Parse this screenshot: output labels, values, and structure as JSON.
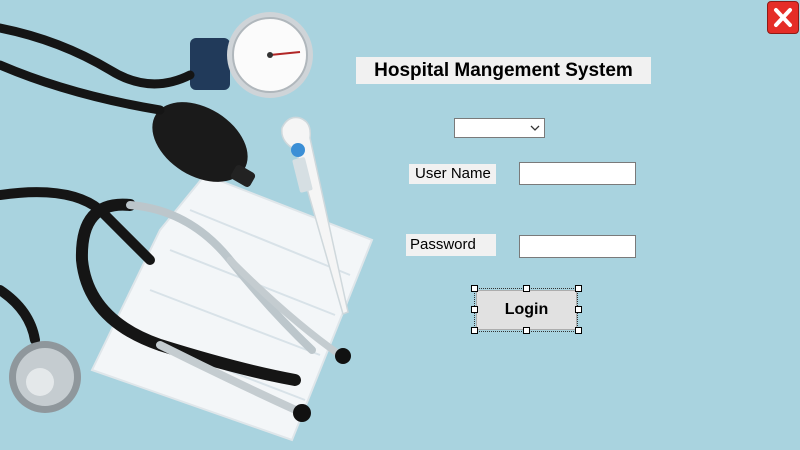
{
  "window": {
    "title": "Hospital Mangement System",
    "close_icon": "close-icon",
    "accent_close": "#e52d27",
    "background": "#a9d3df"
  },
  "login": {
    "role_select_value": "",
    "username_label": "User Name",
    "username_value": "",
    "password_label": "Password",
    "password_value": "",
    "login_label": "Login"
  }
}
